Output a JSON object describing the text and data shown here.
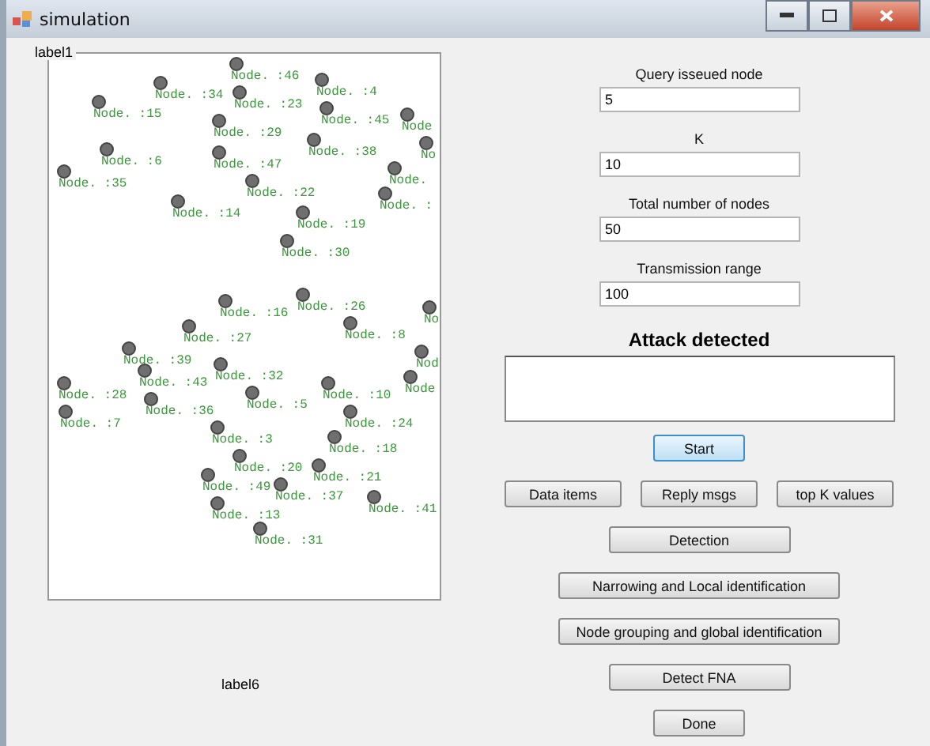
{
  "window": {
    "title": "simulation"
  },
  "canvas": {
    "title": "label1",
    "nodes": [
      {
        "label": "Node. :46"
      },
      {
        "label": "Node. :4"
      },
      {
        "label": "Node. :34"
      },
      {
        "label": "Node. :23"
      },
      {
        "label": "Node. :15"
      },
      {
        "label": "Node. :45"
      },
      {
        "label": "Node"
      },
      {
        "label": "Node. :29"
      },
      {
        "label": "Node. :38"
      },
      {
        "label": "No"
      },
      {
        "label": "Node. :6"
      },
      {
        "label": "Node. :47"
      },
      {
        "label": "Node."
      },
      {
        "label": "Node. :35"
      },
      {
        "label": "Node. :22"
      },
      {
        "label": "Node. :"
      },
      {
        "label": "Node. :14"
      },
      {
        "label": "Node. :19"
      },
      {
        "label": "Node. :30"
      },
      {
        "label": "Node. :26"
      },
      {
        "label": "Node. :16"
      },
      {
        "label": "No"
      },
      {
        "label": "Node. :8"
      },
      {
        "label": "Node. :27"
      },
      {
        "label": "Node. :39"
      },
      {
        "label": "Nod"
      },
      {
        "label": "Node. :32"
      },
      {
        "label": "Node. :43"
      },
      {
        "label": "Node"
      },
      {
        "label": "Node. :28"
      },
      {
        "label": "Node. :10"
      },
      {
        "label": "Node. :5"
      },
      {
        "label": "Node. :36"
      },
      {
        "label": "Node. :7"
      },
      {
        "label": "Node. :24"
      },
      {
        "label": "Node. :3"
      },
      {
        "label": "Node. :18"
      },
      {
        "label": "Node. :20"
      },
      {
        "label": "Node. :21"
      },
      {
        "label": "Node. :49"
      },
      {
        "label": "Node. :37"
      },
      {
        "label": "Node. :41"
      },
      {
        "label": "Node. :13"
      },
      {
        "label": "Node. :31"
      }
    ]
  },
  "status_label": "label6",
  "fields": [
    {
      "label": "Query isseued node",
      "value": "5"
    },
    {
      "label": "K",
      "value": "10"
    },
    {
      "label": "Total number of nodes",
      "value": "50"
    },
    {
      "label": "Transmission range",
      "value": "100"
    }
  ],
  "result": {
    "title": "Attack detected"
  },
  "button_rows": [
    [
      {
        "label": "Start",
        "focused": true
      }
    ],
    [
      {
        "label": "Data items",
        "focused": false
      },
      {
        "label": "Reply msgs",
        "focused": false
      },
      {
        "label": "top K values",
        "focused": false
      }
    ],
    [
      {
        "label": "Detection",
        "focused": false
      }
    ],
    [
      {
        "label": "Narrowing and Local identification",
        "focused": false
      }
    ],
    [
      {
        "label": "Node grouping and global identification",
        "focused": false
      }
    ],
    [
      {
        "label": "Detect FNA",
        "focused": false
      }
    ],
    [
      {
        "label": "Done",
        "focused": false
      }
    ]
  ]
}
